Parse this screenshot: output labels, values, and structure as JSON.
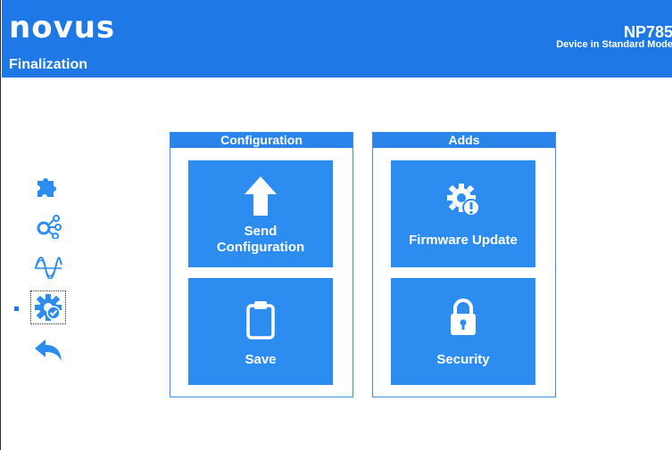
{
  "header": {
    "logo_text": "novus",
    "page_title": "Finalization",
    "device_model": "NP785",
    "device_mode": "Device in Standard Mode"
  },
  "nav": {
    "items": [
      {
        "name": "plugin-icon"
      },
      {
        "name": "connections-icon"
      },
      {
        "name": "signal-icon"
      },
      {
        "name": "gear-check-icon",
        "active": true
      },
      {
        "name": "back-arrow-icon"
      }
    ]
  },
  "groups": {
    "configuration": {
      "title": "Configuration",
      "send_label_line1": "Send",
      "send_label_line2": "Configuration",
      "save_label": "Save"
    },
    "adds": {
      "title": "Adds",
      "firmware_label": "Firmware Update",
      "security_label": "Security"
    }
  },
  "colors": {
    "header": "#1e78e6",
    "tile": "#2d8cf0",
    "group_border": "#3d8ee8"
  }
}
